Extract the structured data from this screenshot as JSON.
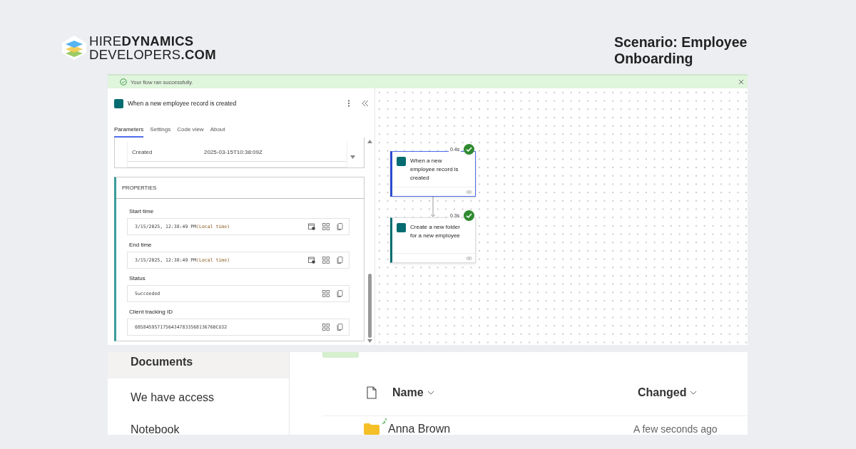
{
  "logo": {
    "line_1": "HIRE**DYNAMICS**",
    "line_2": "DEVELOPERS**.COM**"
  },
  "scenario_title": "Scenario: Employee Onboarding",
  "flow": {
    "banner": {
      "message": "Your flow ran successfully."
    },
    "panel": {
      "title": "When a new employee record is created",
      "tabs": [
        {
          "label": "Parameters",
          "selected": true
        },
        {
          "label": "Settings",
          "selected": false
        },
        {
          "label": "Code view",
          "selected": false
        },
        {
          "label": "About",
          "selected": false
        }
      ],
      "outputs": [
        {
          "name": "Created",
          "value": "2025-03-15T10:38:09Z"
        }
      ],
      "section": "PROPERTIES",
      "properties": [
        {
          "label": "Start time",
          "value": "3/15/2025, 12:38:49 PM",
          "note": "(Local time)",
          "kind": "time"
        },
        {
          "label": "End time",
          "value": "3/15/2025, 12:38:49 PM",
          "note": "(Local time)",
          "kind": "time"
        },
        {
          "label": "Status",
          "value": "Succeeded",
          "kind": "text"
        },
        {
          "label": "Client tracking ID",
          "value": "08584595717564347833568136760CU32",
          "kind": "text"
        }
      ]
    },
    "nodes": [
      {
        "title": "When a new employee record is created",
        "duration": "0.4s",
        "succeeded": true,
        "selected": true
      },
      {
        "title": "Create a new folder for a new employee",
        "duration": "0.3s",
        "succeeded": true,
        "selected": false
      }
    ]
  },
  "library": {
    "nav": [
      {
        "label": "Documents",
        "selected": true
      },
      {
        "label": "We have access",
        "selected": false
      },
      {
        "label": "Notebook",
        "selected": false
      }
    ],
    "columns": [
      "Name",
      "Changed"
    ],
    "rows": [
      {
        "name": "Anna Brown",
        "changed": "A few seconds ago",
        "kind": "folder",
        "new": true
      }
    ]
  }
}
